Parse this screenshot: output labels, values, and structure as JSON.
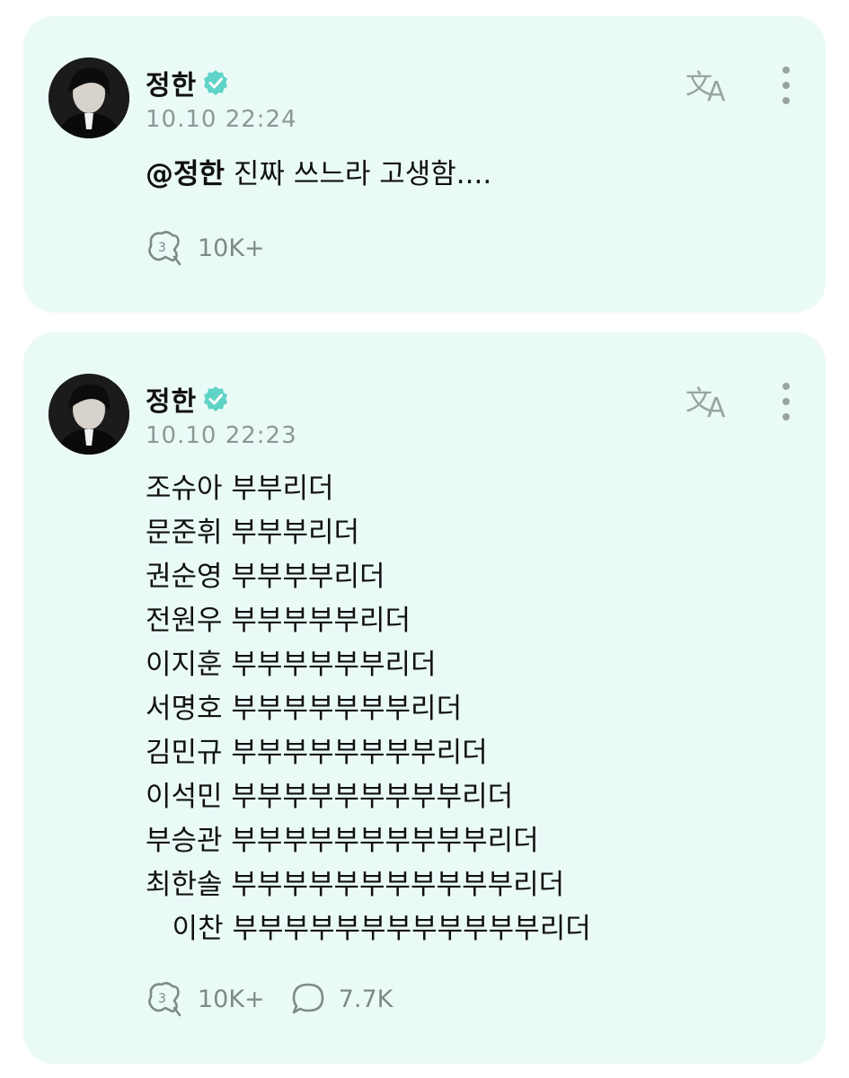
{
  "posts": [
    {
      "author": "정한",
      "verified": true,
      "time": "10.10 22:24",
      "mention": "@정한",
      "text": " 진짜 쓰느라 고생함....",
      "stats": {
        "likes": "10K+"
      }
    },
    {
      "author": "정한",
      "verified": true,
      "time": "10.10 22:23",
      "lines": [
        "조슈아 부부리더",
        "문준휘 부부부리더",
        "권순영 부부부부리더",
        "전원우 부부부부부리더",
        "이지훈 부부부부부부리더",
        "서명호 부부부부부부부리더",
        "김민규 부부부부부부부부리더",
        "이석민 부부부부부부부부부리더",
        "부승관 부부부부부부부부부부리더",
        "최한솔 부부부부부부부부부부부리더",
        "   이찬 부부부부부부부부부부부부리더"
      ],
      "stats": {
        "likes": "10K+",
        "comments": "7.7K"
      }
    }
  ],
  "icons": {
    "verified": "verified-badge-icon",
    "translate": "translate-icon",
    "more": "more-vertical-icon",
    "like": "like-icon",
    "comment": "comment-icon"
  },
  "colors": {
    "card_bg": "#eafaf7",
    "verified": "#5fd3c6",
    "muted": "#8c9896"
  }
}
